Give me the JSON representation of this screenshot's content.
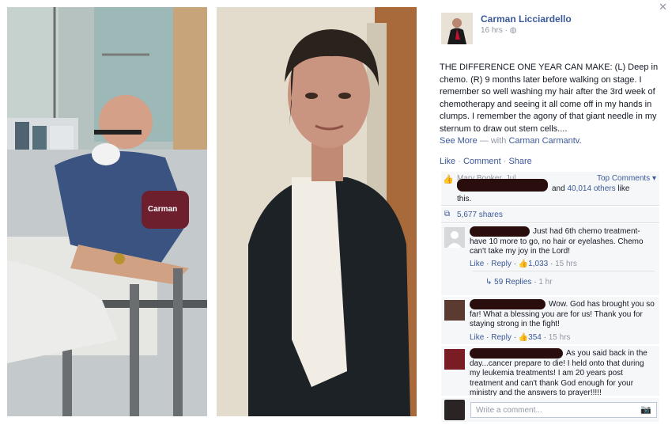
{
  "photos": {
    "left_caption": "",
    "wristband_text": "Carman"
  },
  "post": {
    "author": "Carman Licciardello",
    "time": "16 hrs",
    "privacy_separator": "·",
    "text": "THE DIFFERENCE ONE YEAR CAN MAKE: (L) Deep in chemo. (R) 9 months later before walking on stage. I remember so well washing my hair after the 3rd week of chemotherapy and seeing it all come off in my hands in clumps. I remember the agony of that giant needle in my sternum to draw out stem cells....",
    "see_more": "See More",
    "with_prefix": " — with ",
    "with_names": "Carman Carmantv",
    "with_suffix": "."
  },
  "actions": {
    "like": "Like",
    "comment": "Comment",
    "share": "Share",
    "sep": " · "
  },
  "ufi": {
    "top_comments": "Top Comments",
    "likes_partial": "Mary Booker, Jul",
    "likes_and": "and",
    "likes_count": "40,014 others",
    "likes_tail": "like",
    "likes_tail2": "this.",
    "shares": "5,677 shares"
  },
  "comments": [
    {
      "text": "Just had 6th chemo treatment- have 10 more to go, no hair or eyelashes. Chemo can't take my joy in the Lord!",
      "like": "Like",
      "reply": "Reply",
      "likes": "1,033",
      "time": "15 hrs",
      "replies": "59 Replies",
      "replies_time": "1 hr"
    },
    {
      "text": "Wow. God has brought you so far! What a blessing you are for us! Thank you for staying strong in the fight!",
      "like": "Like",
      "reply": "Reply",
      "likes": "354",
      "time": "15 hrs"
    },
    {
      "text": "As you said back in the day...cancer prepare to die! I held onto that during my leukemia treatments! I am 20 years post treatment and can't thank God enough for your ministry and the answers to prayer!!!!!"
    }
  ],
  "compose": {
    "placeholder": "Write a comment..."
  },
  "colors": {
    "link": "#3b5998",
    "meta": "#9197a3",
    "panel_bg": "#f6f7f8",
    "redaction": "#2a0d0d"
  }
}
